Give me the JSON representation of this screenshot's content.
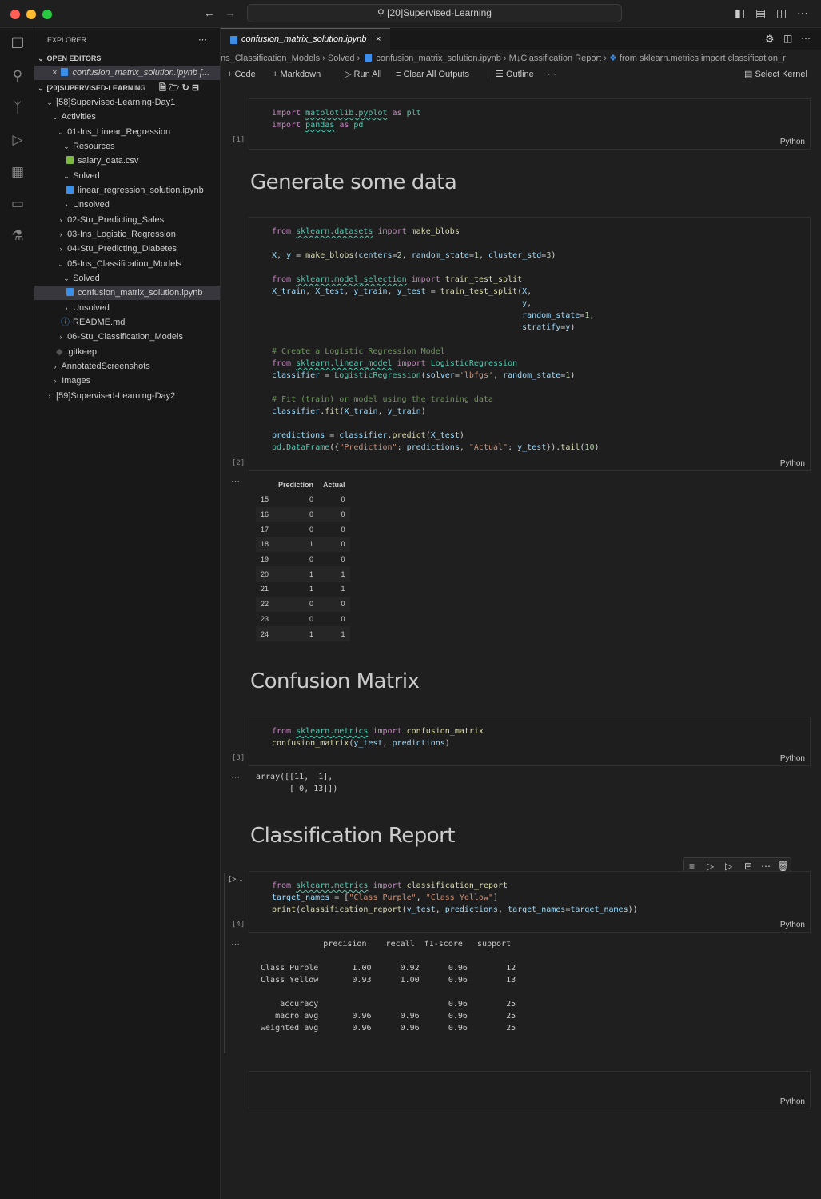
{
  "window": {
    "search_text": "[20]Supervised-Learning"
  },
  "sidebar": {
    "title": "EXPLORER",
    "open_editors": "OPEN EDITORS",
    "open_file": "confusion_matrix_solution.ipynb",
    "workspace": "[20]SUPERVISED-LEARNING",
    "tree": [
      "[58]Supervised-Learning-Day1",
      "Activities",
      "01-Ins_Linear_Regression",
      "Resources",
      "salary_data.csv",
      "Solved",
      "linear_regression_solution.ipynb",
      "Unsolved",
      "02-Stu_Predicting_Sales",
      "03-Ins_Logistic_Regression",
      "04-Stu_Predicting_Diabetes",
      "05-Ins_Classification_Models",
      "Solved",
      "confusion_matrix_solution.ipynb",
      "Unsolved",
      "README.md",
      "06-Stu_Classification_Models",
      ".gitkeep",
      "AnnotatedScreenshots",
      "Images",
      "[59]Supervised-Learning-Day2"
    ]
  },
  "editor": {
    "tab_label": "confusion_matrix_solution.ipynb",
    "breadcrumb": [
      "ns_Classification_Models",
      "Solved",
      "confusion_matrix_solution.ipynb",
      "M↓Classification Report",
      "from sklearn.metrics import classification_r"
    ],
    "toolbar": {
      "code": "Code",
      "markdown": "Markdown",
      "run_all": "Run All",
      "clear": "Clear All Outputs",
      "outline": "Outline",
      "kernel": "Select Kernel"
    },
    "lang": "Python",
    "headings": {
      "h1": "Generate some data",
      "h2": "Confusion Matrix",
      "h3": "Classification Report"
    },
    "exec": {
      "c1": "[1]",
      "c2": "[2]",
      "c3": "[3]",
      "c4": "[4]"
    },
    "df": {
      "headers": [
        "Prediction",
        "Actual"
      ],
      "rows": [
        [
          "15",
          "0",
          "0"
        ],
        [
          "16",
          "0",
          "0"
        ],
        [
          "17",
          "0",
          "0"
        ],
        [
          "18",
          "1",
          "0"
        ],
        [
          "19",
          "0",
          "0"
        ],
        [
          "20",
          "1",
          "1"
        ],
        [
          "21",
          "1",
          "1"
        ],
        [
          "22",
          "0",
          "0"
        ],
        [
          "23",
          "0",
          "0"
        ],
        [
          "24",
          "1",
          "1"
        ]
      ]
    },
    "out3": "array([[11,  1],\n       [ 0, 13]])",
    "out4": "              precision    recall  f1-score   support\n\n Class Purple       1.00      0.92      0.96        12\n Class Yellow       0.93      1.00      0.96        13\n\n     accuracy                           0.96        25\n    macro avg       0.96      0.96      0.96        25\n weighted avg       0.96      0.96      0.96        25"
  }
}
